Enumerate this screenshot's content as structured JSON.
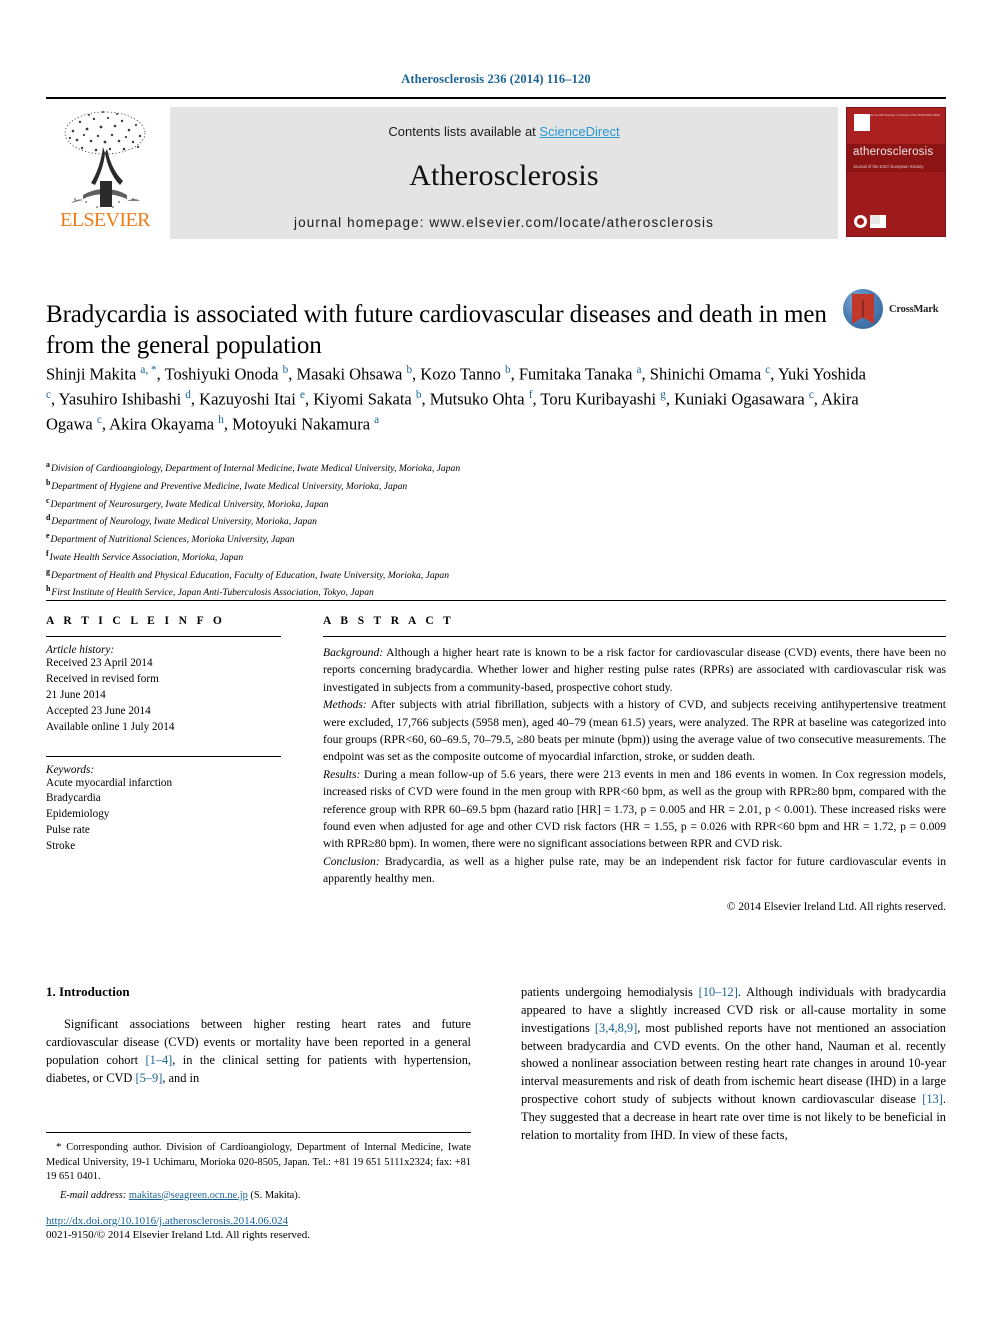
{
  "running_head": "Atherosclerosis 236 (2014) 116–120",
  "masthead": {
    "publisher": "ELSEVIER",
    "contents_prefix": "Contents lists available at ",
    "sciencedirect": "ScienceDirect",
    "journal_title": "Atherosclerosis",
    "homepage": "journal homepage: www.elsevier.com/locate/atherosclerosis",
    "cover": {
      "title": "atherosclerosis",
      "subtitle": "Journal of the ESC/ European Society",
      "topline": "Volume 236  Number 1   October 2014   ISSN 0021-9150"
    }
  },
  "article": {
    "title": "Bradycardia is associated with future cardiovascular diseases and death in men from the general population",
    "crossmark_label": "CrossMark",
    "authors_html": "Shinji Makita <sup class=\"star\">a, *</sup>, Toshiyuki Onoda <sup>b</sup>, Masaki Ohsawa <sup>b</sup>, Kozo Tanno <sup>b</sup>, Fumitaka Tanaka <sup>a</sup>, Shinichi Omama <sup>c</sup>, Yuki Yoshida <sup>c</sup>, Yasuhiro Ishibashi <sup>d</sup>, Kazuyoshi Itai <sup>e</sup>, Kiyomi Sakata <sup>b</sup>, Mutsuko Ohta <sup>f</sup>, Toru Kuribayashi <sup>g</sup>, Kuniaki Ogasawara <sup>c</sup>, Akira Ogawa <sup>c</sup>, Akira Okayama <sup>h</sup>, Motoyuki Nakamura <sup>a</sup>",
    "affiliations": [
      {
        "mark": "a",
        "text": "Division of Cardioangiology, Department of Internal Medicine, Iwate Medical University, Morioka, Japan"
      },
      {
        "mark": "b",
        "text": "Department of Hygiene and Preventive Medicine, Iwate Medical University, Morioka, Japan"
      },
      {
        "mark": "c",
        "text": "Department of Neurosurgery, Iwate Medical University, Morioka, Japan"
      },
      {
        "mark": "d",
        "text": "Department of Neurology, Iwate Medical University, Morioka, Japan"
      },
      {
        "mark": "e",
        "text": "Department of Nutritional Sciences, Morioka University, Japan"
      },
      {
        "mark": "f",
        "text": "Iwate Health Service Association, Morioka, Japan"
      },
      {
        "mark": "g",
        "text": "Department of Health and Physical Education, Faculty of Education, Iwate University, Morioka, Japan"
      },
      {
        "mark": "h",
        "text": "First Institute of Health Service, Japan Anti-Tuberculosis Association, Tokyo, Japan"
      }
    ]
  },
  "article_info": {
    "heading": "A R T I C L E   I N F O",
    "history_label": "Article history:",
    "history": [
      "Received 23 April 2014",
      "Received in revised form",
      "21 June 2014",
      "Accepted 23 June 2014",
      "Available online 1 July 2014"
    ],
    "keywords_label": "Keywords:",
    "keywords": [
      "Acute myocardial infarction",
      "Bradycardia",
      "Epidemiology",
      "Pulse rate",
      "Stroke"
    ]
  },
  "abstract": {
    "heading": "A B S T R A C T",
    "background_label": "Background:",
    "background": " Although a higher heart rate is known to be a risk factor for cardiovascular disease (CVD) events, there have been no reports concerning bradycardia. Whether lower and higher resting pulse rates (RPRs) are associated with cardiovascular risk was investigated in subjects from a community-based, prospective cohort study.",
    "methods_label": "Methods:",
    "methods": " After subjects with atrial fibrillation, subjects with a history of CVD, and subjects receiving antihypertensive treatment were excluded, 17,766 subjects (5958 men), aged 40–79 (mean 61.5) years, were analyzed. The RPR at baseline was categorized into four groups (RPR<60, 60–69.5, 70–79.5, ≥80 beats per minute (bpm)) using the average value of two consecutive measurements. The endpoint was set as the composite outcome of myocardial infarction, stroke, or sudden death.",
    "results_label": "Results:",
    "results": " During a mean follow-up of 5.6 years, there were 213 events in men and 186 events in women. In Cox regression models, increased risks of CVD were found in the men group with RPR<60 bpm, as well as the group with RPR≥80 bpm, compared with the reference group with RPR 60–69.5 bpm (hazard ratio [HR] = 1.73, p = 0.005 and HR = 2.01, p < 0.001). These increased risks were found even when adjusted for age and other CVD risk factors (HR = 1.55, p = 0.026 with RPR<60 bpm and HR = 1.72, p = 0.009 with RPR≥80 bpm). In women, there were no significant associations between RPR and CVD risk.",
    "conclusion_label": "Conclusion:",
    "conclusion": " Bradycardia, as well as a higher pulse rate, may be an independent risk factor for future cardiovascular events in apparently healthy men.",
    "copyright": "© 2014 Elsevier Ireland Ltd. All rights reserved."
  },
  "introduction": {
    "heading": "1. Introduction",
    "left_paragraph_html": "Significant associations between higher resting heart rates and future cardiovascular disease (CVD) events or mortality have been reported in a general population cohort <span class=\"ref\">[1–4]</span>, in the clinical setting for patients with hypertension, diabetes, or CVD <span class=\"ref\">[5–9]</span>, and in",
    "right_paragraph_html": "patients undergoing hemodialysis <span class=\"ref\">[10–12]</span>. Although individuals with bradycardia appeared to have a slightly increased CVD risk or all-cause mortality in some investigations <span class=\"ref\">[3,4,8,9]</span>, most published reports have not mentioned an association between bradycardia and CVD events. On the other hand, Nauman et al. recently showed a nonlinear association between resting heart rate changes in around 10-year interval measurements and risk of death from ischemic heart disease (IHD) in a large prospective cohort study of subjects without known cardiovascular disease <span class=\"ref\">[13]</span>. They suggested that a decrease in heart rate over time is not likely to be beneficial in relation to mortality from IHD. In view of these facts,"
  },
  "footnote": {
    "corresponding_html": "<span style=\"font-size:11px\">*</span> Corresponding author. Division of Cardioangiology, Department of Internal Medicine, Iwate Medical University, 19-1 Uchimaru, Morioka 020-8505, Japan. Tel.: +81 19 651 5111x2324; fax: +81 19 651 0401.",
    "email_label": "E-mail address:",
    "email": "makitas@seagreen.ocn.ne.jp",
    "email_suffix": " (S. Makita).",
    "doi": "http://dx.doi.org/10.1016/j.atherosclerosis.2014.06.024",
    "issn": "0021-9150/© 2014 Elsevier Ireland Ltd. All rights reserved."
  }
}
